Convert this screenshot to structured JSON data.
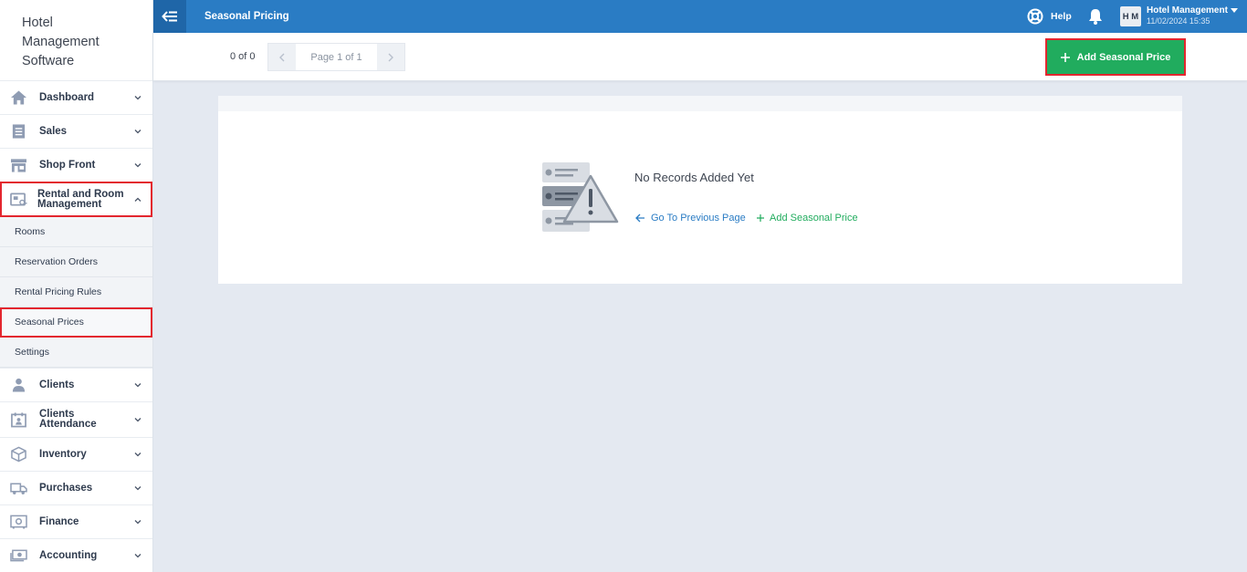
{
  "app": {
    "brand_lines": [
      "Hotel",
      "Management",
      "Software"
    ]
  },
  "topbar": {
    "title": "Seasonal Pricing",
    "help_label": "Help",
    "avatar_initials": "H M",
    "user_name": "Hotel Management",
    "user_date": "11/02/2024 15:35",
    "colors": {
      "bar": "#2a7cc4",
      "back": "#1f66a8"
    }
  },
  "sidebar": {
    "items_top": [
      {
        "label": "Dashboard",
        "icon": "home-icon"
      },
      {
        "label": "Sales",
        "icon": "receipt-icon"
      },
      {
        "label": "Shop Front",
        "icon": "storefront-icon"
      }
    ],
    "active_group": {
      "label_line1": "Rental and Room",
      "label_line2": "Management",
      "icon": "room-key-icon"
    },
    "sub_items": [
      "Rooms",
      "Reservation Orders",
      "Rental Pricing Rules",
      "Seasonal Prices",
      "Settings"
    ],
    "active_sub_index": 3,
    "items_bottom": [
      {
        "label": "Clients",
        "icon": "client-icon"
      },
      {
        "label_line1": "Clients",
        "label_line2": "Attendance",
        "icon": "calendar-person-icon"
      },
      {
        "label": "Inventory",
        "icon": "box-icon"
      },
      {
        "label": "Purchases",
        "icon": "truck-icon"
      },
      {
        "label": "Finance",
        "icon": "safe-icon"
      },
      {
        "label": "Accounting",
        "icon": "money-icon"
      }
    ]
  },
  "toolbar": {
    "record_count": "0 of 0",
    "page_label": "Page 1 of 1",
    "add_button_label": "Add Seasonal Price",
    "colors": {
      "add_button": "#21ac5e",
      "highlight": "#e3262e"
    }
  },
  "empty_state": {
    "title": "No Records Added Yet",
    "prev_link": "Go To Previous Page",
    "add_link": "Add Seasonal Price"
  }
}
